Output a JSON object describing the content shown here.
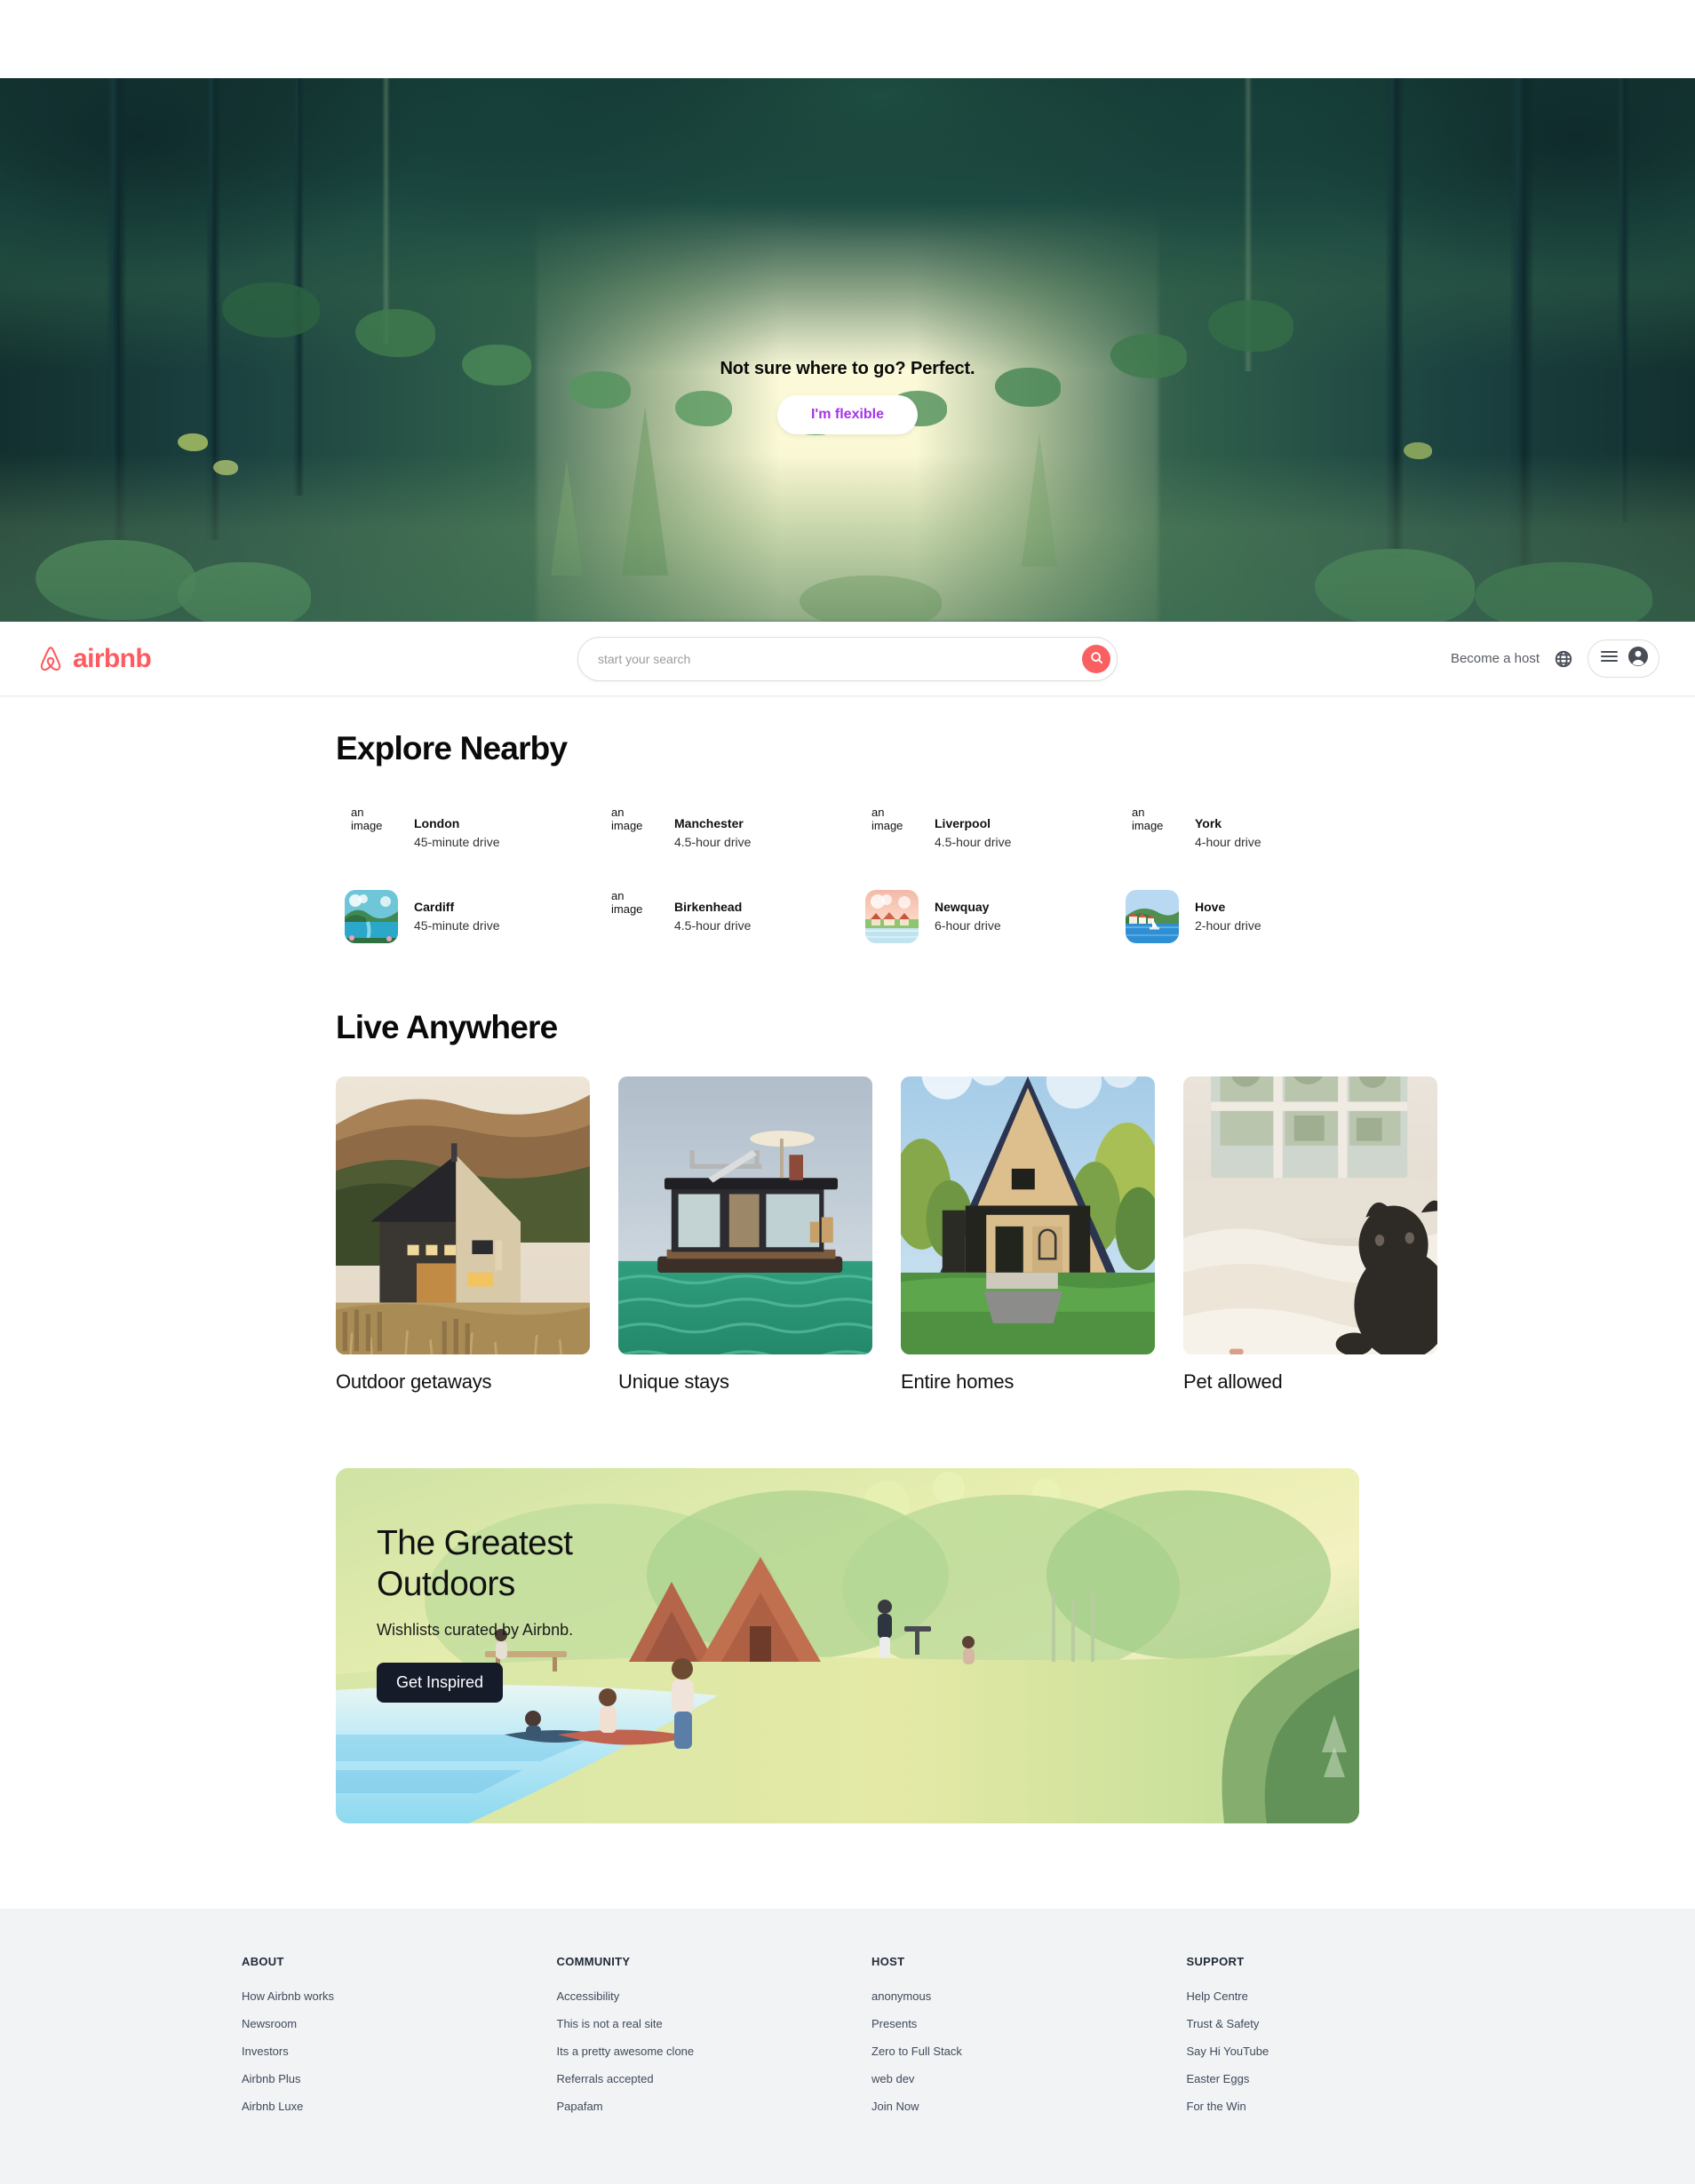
{
  "header": {
    "logo_text": "airbnb",
    "search": {
      "placeholder": "start your search",
      "value": "",
      "search_icon": "search-icon"
    },
    "become_host_label": "Become a host",
    "globe_icon": "globe-icon",
    "menu_icon": "hamburger-icon",
    "avatar_icon": "user-avatar-icon",
    "accent_color": "#fa5f62"
  },
  "hero": {
    "title": "Not sure where to go? Perfect.",
    "cta_label": "I'm flexible",
    "cta_text_color": "#a733e8"
  },
  "explore": {
    "title": "Explore Nearby",
    "broken_image_alt": "an image",
    "items": [
      {
        "city": "London",
        "drive": "45-minute drive",
        "image_loaded": false,
        "scene": "lake"
      },
      {
        "city": "Manchester",
        "drive": "4.5-hour drive",
        "image_loaded": false,
        "scene": "lake"
      },
      {
        "city": "Liverpool",
        "drive": "4.5-hour drive",
        "image_loaded": false,
        "scene": "lake"
      },
      {
        "city": "York",
        "drive": "4-hour drive",
        "image_loaded": false,
        "scene": "lake"
      },
      {
        "city": "Cardiff",
        "drive": "45-minute drive",
        "image_loaded": true,
        "scene": "lake"
      },
      {
        "city": "Birkenhead",
        "drive": "4.5-hour drive",
        "image_loaded": false,
        "scene": "lake"
      },
      {
        "city": "Newquay",
        "drive": "6-hour drive",
        "image_loaded": true,
        "scene": "village"
      },
      {
        "city": "Hove",
        "drive": "2-hour drive",
        "image_loaded": true,
        "scene": "harbour"
      }
    ]
  },
  "live_anywhere": {
    "title": "Live Anywhere",
    "cards": [
      {
        "label": "Outdoor getaways",
        "scene": "cabin-hillside"
      },
      {
        "label": "Unique stays",
        "scene": "floating-house"
      },
      {
        "label": "Entire homes",
        "scene": "a-frame-house"
      },
      {
        "label": "Pet allowed",
        "scene": "dog-on-bed"
      }
    ]
  },
  "promo": {
    "title": "The Greatest\nOutdoors",
    "subtitle": "Wishlists curated by Airbnb.",
    "button_label": "Get Inspired",
    "button_color": "#161b29"
  },
  "footer": {
    "columns": [
      {
        "heading": "ABOUT",
        "links": [
          "How Airbnb works",
          "Newsroom",
          "Investors",
          "Airbnb Plus",
          "Airbnb Luxe"
        ]
      },
      {
        "heading": "COMMUNITY",
        "links": [
          "Accessibility",
          "This is not a real site",
          "Its a pretty awesome clone",
          "Referrals accepted",
          "Papafam"
        ]
      },
      {
        "heading": "HOST",
        "links": [
          "anonymous",
          "Presents",
          "Zero to Full Stack",
          "web dev",
          "Join Now"
        ]
      },
      {
        "heading": "SUPPORT",
        "links": [
          "Help Centre",
          "Trust & Safety",
          "Say Hi YouTube",
          "Easter Eggs",
          "For the Win"
        ]
      }
    ]
  }
}
